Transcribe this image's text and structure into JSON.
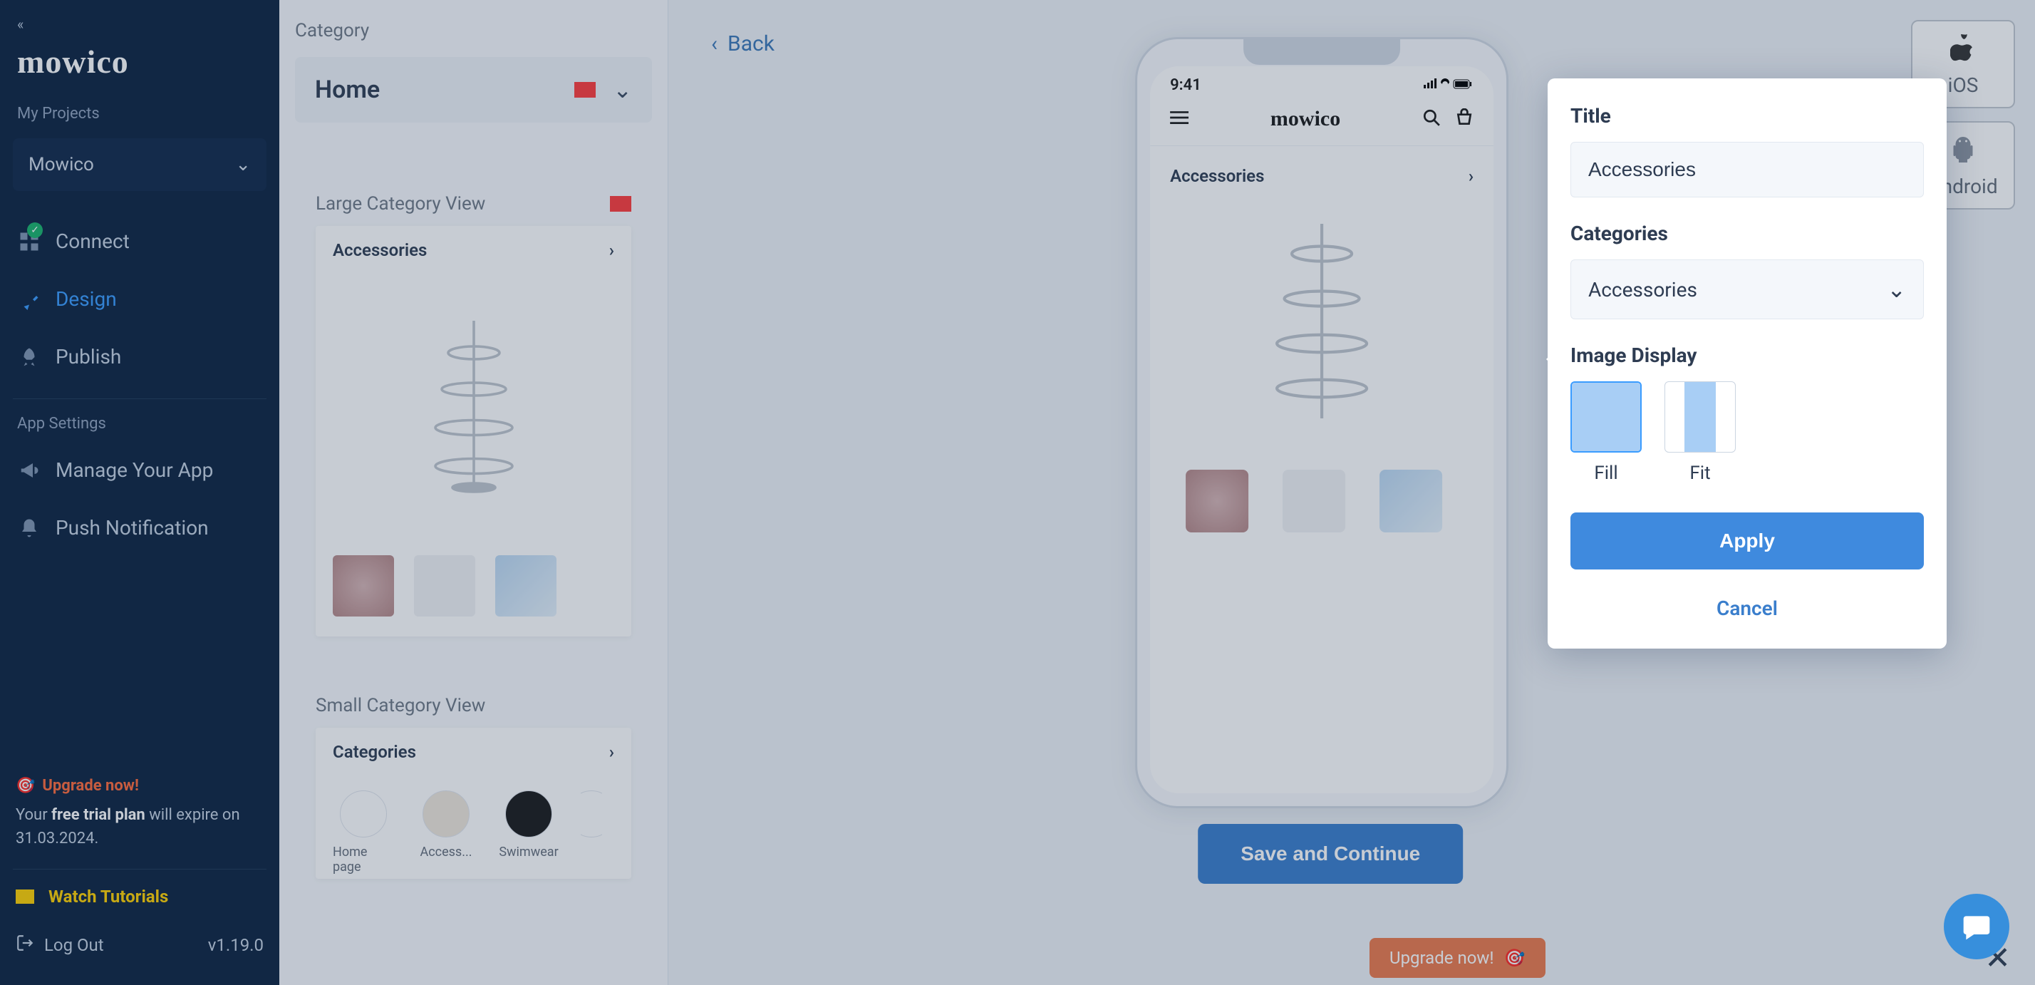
{
  "sidebar": {
    "brand": "mowico",
    "my_projects_label": "My Projects",
    "project_selector": "Mowico",
    "nav": [
      {
        "icon": "grid-icon",
        "label": "Connect",
        "active": false,
        "checked": true
      },
      {
        "icon": "pin-icon",
        "label": "Design",
        "active": true,
        "checked": false
      },
      {
        "icon": "rocket-icon",
        "label": "Publish",
        "active": false,
        "checked": false
      }
    ],
    "app_settings_label": "App Settings",
    "settings": [
      {
        "icon": "megaphone-icon",
        "label": "Manage Your App"
      },
      {
        "icon": "bell-icon",
        "label": "Push Notification"
      }
    ],
    "upgrade_label": "Upgrade now!",
    "trial_prefix": "Your ",
    "trial_bold": "free trial plan",
    "trial_suffix": " will expire on ",
    "trial_date": "31.03.2024.",
    "watch_tutorials": "Watch Tutorials",
    "logout": "Log Out",
    "version": "v1.19.0"
  },
  "config_panel": {
    "title": "Category",
    "home_label": "Home",
    "large_view_label": "Large Category View",
    "large_category_name": "Accessories",
    "small_view_label": "Small Category View",
    "small_categories_header": "Categories",
    "small_cats": [
      "Home page",
      "Access...",
      "Swimwear"
    ]
  },
  "workspace": {
    "back_label": "Back",
    "save_label": "Save and Continue",
    "phone": {
      "time": "9:41",
      "logo": "mowico",
      "category_label": "Accessories"
    },
    "platforms": [
      {
        "name": "ios",
        "label": "iOS"
      },
      {
        "name": "android",
        "label": "Android"
      }
    ]
  },
  "banner": {
    "upgrade_label": "Upgrade now!"
  },
  "property_panel": {
    "title_label": "Title",
    "title_value": "Accessories",
    "categories_label": "Categories",
    "categories_value": "Accessories",
    "image_display_label": "Image Display",
    "fill_label": "Fill",
    "fit_label": "Fit",
    "apply_label": "Apply",
    "cancel_label": "Cancel"
  }
}
